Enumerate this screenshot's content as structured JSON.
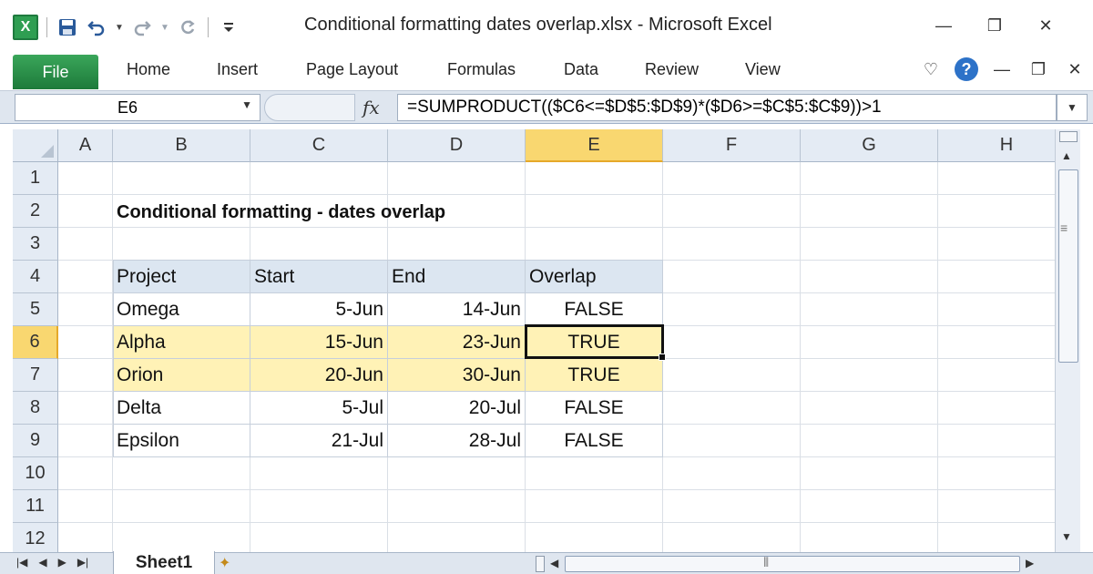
{
  "window": {
    "title": "Conditional formatting dates overlap.xlsx  -  Microsoft Excel",
    "app_icon_letter": "X"
  },
  "quick_access": {
    "save_icon": "save-icon",
    "undo_icon": "undo-icon",
    "redo_icon": "redo-icon",
    "repeat_icon": "repeat-icon",
    "customize_icon": "customize-icon"
  },
  "ribbon": {
    "file_label": "File",
    "tabs": [
      "Home",
      "Insert",
      "Page Layout",
      "Formulas",
      "Data",
      "Review",
      "View"
    ],
    "help_label": "?"
  },
  "formula_bar": {
    "name_box": "E6",
    "fx_label": "fx",
    "formula": "=SUMPRODUCT(($C6<=$D$5:$D$9)*($D6>=$C$5:$C$9))>1"
  },
  "columns": [
    "A",
    "B",
    "C",
    "D",
    "E",
    "F",
    "G",
    "H"
  ],
  "rows": [
    "1",
    "2",
    "3",
    "4",
    "5",
    "6",
    "7",
    "8",
    "9",
    "10",
    "11",
    "12"
  ],
  "sheet": {
    "title": "Conditional formatting - dates overlap",
    "table": {
      "headers": [
        "Project",
        "Start",
        "End",
        "Overlap"
      ],
      "rows": [
        [
          "Omega",
          "5-Jun",
          "14-Jun",
          "FALSE"
        ],
        [
          "Alpha",
          "15-Jun",
          "23-Jun",
          "TRUE"
        ],
        [
          "Orion",
          "20-Jun",
          "30-Jun",
          "TRUE"
        ],
        [
          "Delta",
          "5-Jul",
          "20-Jul",
          "FALSE"
        ],
        [
          "Epsilon",
          "21-Jul",
          "28-Jul",
          "FALSE"
        ]
      ],
      "highlighted_rows": [
        1,
        2
      ],
      "highlight_color": "#fff2b6",
      "header_color": "#dce6f1"
    }
  },
  "selection": {
    "active_cell": "E6",
    "active_column": "E",
    "active_row": "6"
  },
  "sheet_tabs": {
    "active": "Sheet1"
  },
  "colors": {
    "file_tab": "#2f9e52",
    "selected_header": "#f9d770"
  }
}
